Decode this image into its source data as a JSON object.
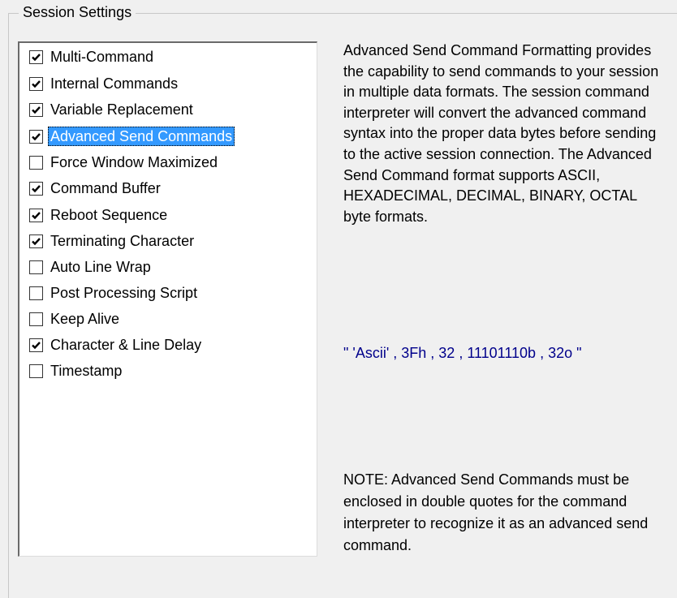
{
  "group": {
    "label": "Session Settings"
  },
  "list": {
    "items": [
      {
        "label": "Multi-Command",
        "checked": true
      },
      {
        "label": "Internal Commands",
        "checked": true
      },
      {
        "label": "Variable Replacement",
        "checked": true
      },
      {
        "label": "Advanced Send Commands",
        "checked": true,
        "selected": true
      },
      {
        "label": "Force Window Maximized",
        "checked": false
      },
      {
        "label": "Command Buffer",
        "checked": true
      },
      {
        "label": "Reboot Sequence",
        "checked": true
      },
      {
        "label": "Terminating Character",
        "checked": true
      },
      {
        "label": "Auto Line Wrap",
        "checked": false
      },
      {
        "label": "Post Processing Script",
        "checked": false
      },
      {
        "label": "Keep Alive",
        "checked": false
      },
      {
        "label": "Character & Line Delay",
        "checked": true
      },
      {
        "label": "Timestamp",
        "checked": false
      }
    ]
  },
  "description": {
    "text": "Advanced Send Command Formatting provides the capability to send commands to your session in multiple data formats.  The session command interpreter will convert the advanced command syntax into the proper data bytes before sending to the active session connection.  The Advanced Send Command format supports ASCII, HEXADECIMAL, DECIMAL, BINARY, OCTAL byte formats.",
    "example": "\" 'Ascii' , 3Fh , 32 , 11101110b , 32o \"",
    "note": "NOTE: Advanced Send Commands must be enclosed in double quotes for the command interpreter to recognize it as an advanced send command."
  },
  "colors": {
    "selection": "#3399ff",
    "example_text": "#00008b"
  }
}
